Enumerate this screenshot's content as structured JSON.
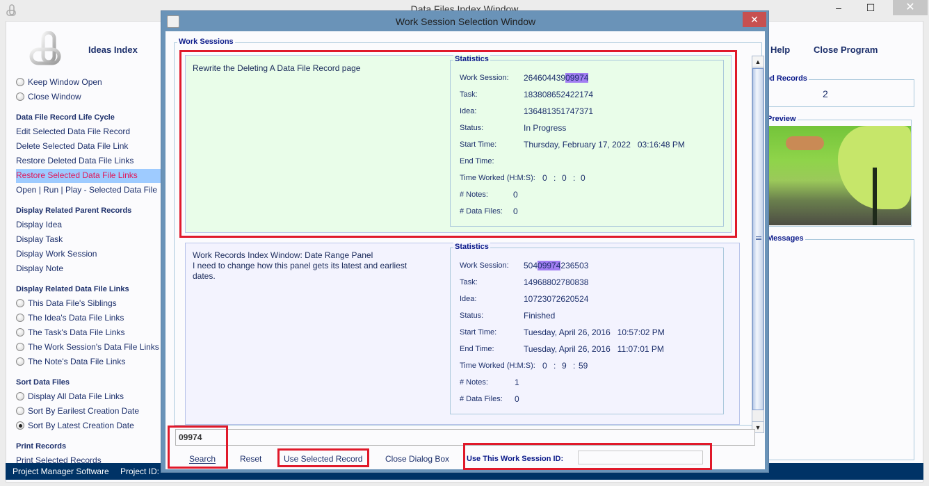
{
  "main_window": {
    "title": "Data Files Index Window",
    "controls": {
      "minimize": "–",
      "maximize": "☐",
      "close": "✕"
    },
    "top_links": [
      {
        "label": "Ideas Index",
        "mnemonic": "I"
      },
      {
        "label": "Help",
        "mnemonic": "H"
      },
      {
        "label": "Close Program",
        "mnemonic": "C"
      }
    ],
    "sidebar": {
      "window_options": [
        {
          "label": "Keep Window Open",
          "checked": false
        },
        {
          "label": "Close Window",
          "checked": false
        }
      ],
      "sections": [
        {
          "heading": "Data File Record Life Cycle",
          "items": [
            "Edit Selected Data File Record",
            "Delete Selected Data File Link",
            "Restore Deleted Data File Links",
            "Restore Selected Data File Links",
            "Open | Run | Play - Selected Data File"
          ],
          "selected_index": 3
        },
        {
          "heading": "Display Related Parent Records",
          "items": [
            "Display Idea",
            "Display Task",
            "Display Work Session",
            "Display Note"
          ]
        },
        {
          "heading": "Display Related Data File Links",
          "radios": [
            "This Data File's Siblings",
            "The Idea's Data File Links",
            "The Task's Data File Links",
            "The Work Session's Data File Links",
            "The Note's Data File Links"
          ]
        },
        {
          "heading": "Sort Data Files",
          "radios": [
            "Display All Data File Links",
            "Sort By Earilest Creation Date",
            "Sort By Latest Creation Date"
          ],
          "checked_index": 2
        },
        {
          "heading": "Print Records",
          "items": [
            "Print Selected Records"
          ]
        }
      ]
    },
    "right_panel": {
      "records_legend": "ed Records",
      "records_count": "2",
      "preview_legend": "Preview",
      "messages_legend": "Messages"
    },
    "status_bar": {
      "app_name": "Project Manager Software",
      "project_label": "Project ID:"
    }
  },
  "dialog": {
    "title": "Work Session Selection Window",
    "close": "✕",
    "work_sessions_legend": "Work Sessions",
    "statistics_legend": "Statistics",
    "labels": {
      "work_session": "Work Session:",
      "task": "Task:",
      "idea": "Idea:",
      "status": "Status:",
      "start_time": "Start Time:",
      "end_time": "End Time:",
      "time_worked": "Time Worked (H:M:S):",
      "notes": "# Notes:",
      "data_files": "# Data Files:"
    },
    "records": [
      {
        "description_lines": [
          "Rewrite the Deleting A Data File Record page"
        ],
        "work_session_pre": "264604439",
        "work_session_hl": "09974",
        "work_session_post": "",
        "task": "183808652422174",
        "idea": "136481351747371",
        "status": "In Progress",
        "start_time": "Thursday, February 17, 2022   03:16:48 PM",
        "end_time": "",
        "time_worked": {
          "h": "0",
          "m": "0",
          "s": "0"
        },
        "notes": "0",
        "data_files": "0",
        "selected": true
      },
      {
        "description_lines": [
          "Work Records Index Window: Date Range Panel",
          "I need to change how this panel gets its latest and earliest",
          "dates."
        ],
        "work_session_pre": "504",
        "work_session_hl": "09974",
        "work_session_post": "236503",
        "task": "14968802780838",
        "idea": "10723072620524",
        "status": "Finished",
        "start_time": "Tuesday, April 26, 2016   10:57:02 PM",
        "end_time": "Tuesday, April 26, 2016   11:07:01 PM",
        "time_worked": {
          "h": "0",
          "m": "9",
          "s": "59"
        },
        "notes": "1",
        "data_files": "0",
        "selected": false
      }
    ],
    "search_value": "09974",
    "buttons": {
      "search": "Search",
      "reset": "Reset",
      "use_selected": "Use Selected Record",
      "close_dialog": "Close Dialog Box"
    },
    "use_id_label": "Use This Work Session ID:",
    "use_id_value": "",
    "colors": {
      "highlight": "#a27ef2",
      "annotation_red": "#e0192a",
      "selected_record_bg": "#e9fde9",
      "status_bar": "#003366"
    }
  }
}
